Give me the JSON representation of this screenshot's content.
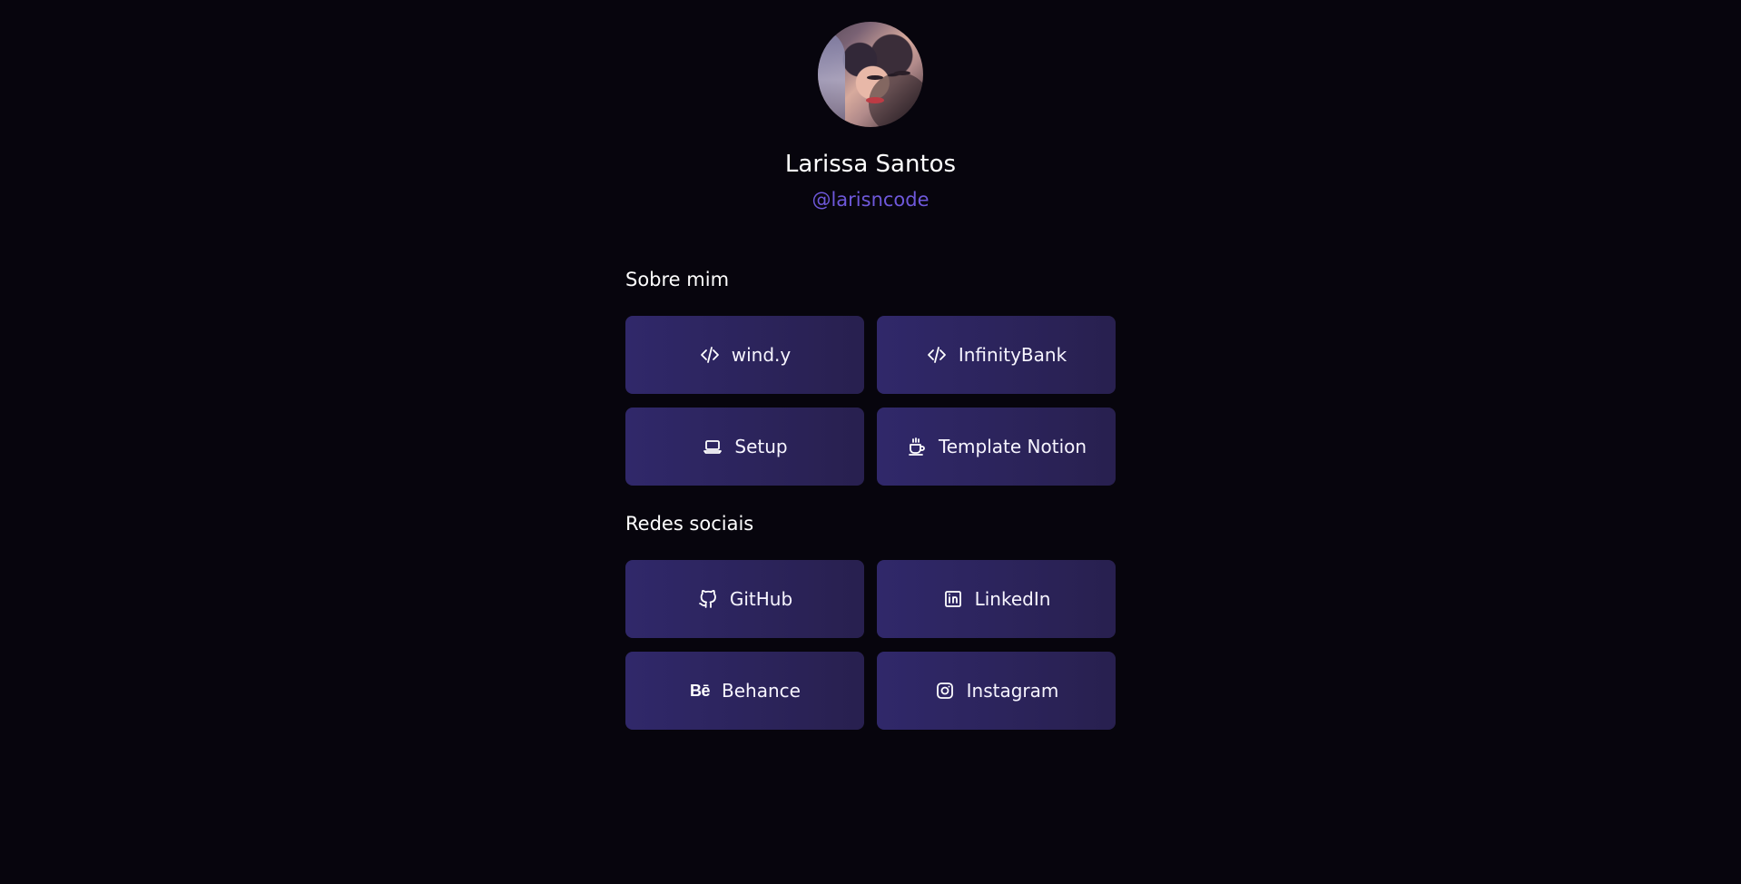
{
  "profile": {
    "name": "Larissa Santos",
    "handle": "@larisncode"
  },
  "sections": [
    {
      "title": "Sobre mim",
      "items": [
        {
          "label": "wind.y",
          "icon": "code-icon"
        },
        {
          "label": "InfinityBank",
          "icon": "code-icon"
        },
        {
          "label": "Setup",
          "icon": "laptop-icon"
        },
        {
          "label": "Template Notion",
          "icon": "coffee-icon"
        }
      ]
    },
    {
      "title": "Redes sociais",
      "items": [
        {
          "label": "GitHub",
          "icon": "github-icon"
        },
        {
          "label": "LinkedIn",
          "icon": "linkedin-icon"
        },
        {
          "label": "Behance",
          "icon": "behance-icon",
          "icon_text": "Bē"
        },
        {
          "label": "Instagram",
          "icon": "instagram-icon"
        }
      ]
    }
  ],
  "colors": {
    "background": "#07050d",
    "card_start": "#30286a",
    "card_end": "#28204f",
    "handle": "#6e58da",
    "text": "#ffffff"
  }
}
